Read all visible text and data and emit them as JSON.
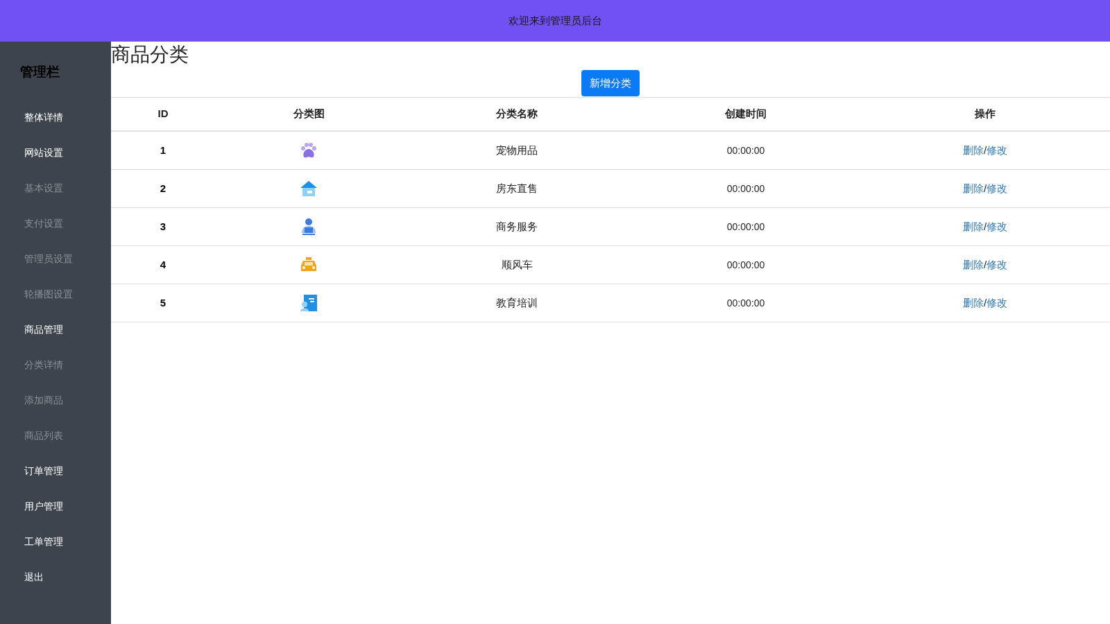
{
  "header": {
    "title": "欢迎来到管理员后台"
  },
  "sidebar": {
    "title": "管理栏",
    "items": [
      {
        "label": "整体详情",
        "kind": "section"
      },
      {
        "label": "网站设置",
        "kind": "section"
      },
      {
        "label": "基本设置",
        "kind": "subitem"
      },
      {
        "label": "支付设置",
        "kind": "subitem"
      },
      {
        "label": "管理员设置",
        "kind": "subitem"
      },
      {
        "label": "轮播图设置",
        "kind": "subitem"
      },
      {
        "label": "商品管理",
        "kind": "section"
      },
      {
        "label": "分类详情",
        "kind": "subitem"
      },
      {
        "label": "添加商品",
        "kind": "subitem"
      },
      {
        "label": "商品列表",
        "kind": "subitem"
      },
      {
        "label": "订单管理",
        "kind": "section"
      },
      {
        "label": "用户管理",
        "kind": "section"
      },
      {
        "label": "工单管理",
        "kind": "section"
      },
      {
        "label": "退出",
        "kind": "section"
      }
    ]
  },
  "page_title": "商品分类",
  "add_button": "新增分类",
  "table": {
    "columns": [
      "ID",
      "分类图",
      "分类名称",
      "创建时间",
      "操作"
    ],
    "rows": [
      {
        "id": "1",
        "name": "宠物用品",
        "time": "00:00:00",
        "actions": [
          "删除",
          "/",
          "修改"
        ]
      },
      {
        "id": "2",
        "name": "房东直售",
        "time": "00:00:00",
        "actions": [
          "删除",
          "/",
          "修改"
        ]
      },
      {
        "id": "3",
        "name": "商务服务",
        "time": "00:00:00",
        "actions": [
          "删除",
          "/",
          "修改"
        ]
      },
      {
        "id": "4",
        "name": "顺风车",
        "time": "00:00:00",
        "actions": [
          "删除",
          "/",
          "修改"
        ]
      },
      {
        "id": "5",
        "name": "教育培训",
        "time": "00:00:00",
        "actions": [
          "删除",
          "/",
          "修改"
        ]
      }
    ]
  }
}
